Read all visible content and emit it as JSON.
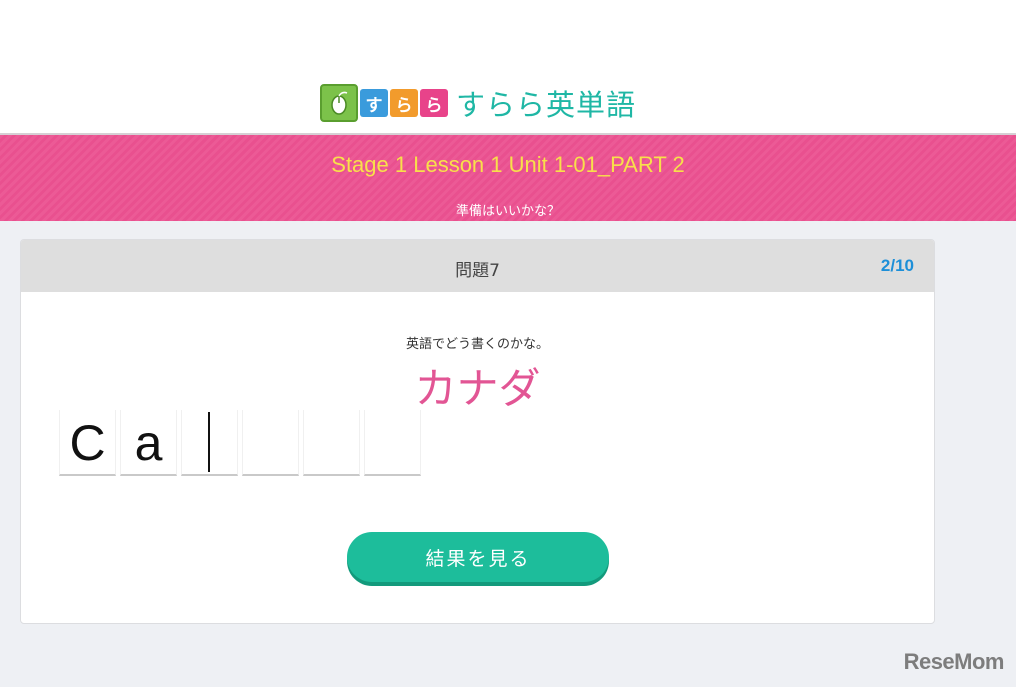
{
  "logo": {
    "tiles": [
      "す",
      "ら",
      "ら"
    ],
    "text": "すらら英単語"
  },
  "banner": {
    "stage_title": "Stage 1 Lesson 1 Unit 1-01_PART 2",
    "ready_text": "準備はいいかな？"
  },
  "question": {
    "number_label": "問題7",
    "progress": "2/10",
    "instruction": "英語でどう書くのかな。",
    "prompt_word": "カナダ",
    "letters": [
      "C",
      "a",
      "",
      "",
      "",
      ""
    ]
  },
  "actions": {
    "result_button": "結果を見る"
  },
  "watermark": "ReseMom",
  "colors": {
    "banner_pink": "#ec5a96",
    "title_yellow": "#f8e04a",
    "progress_blue": "#1d8fd8",
    "prompt_pink": "#e25594",
    "button_green": "#1dbd9b",
    "logo_teal": "#1fb7a5"
  }
}
